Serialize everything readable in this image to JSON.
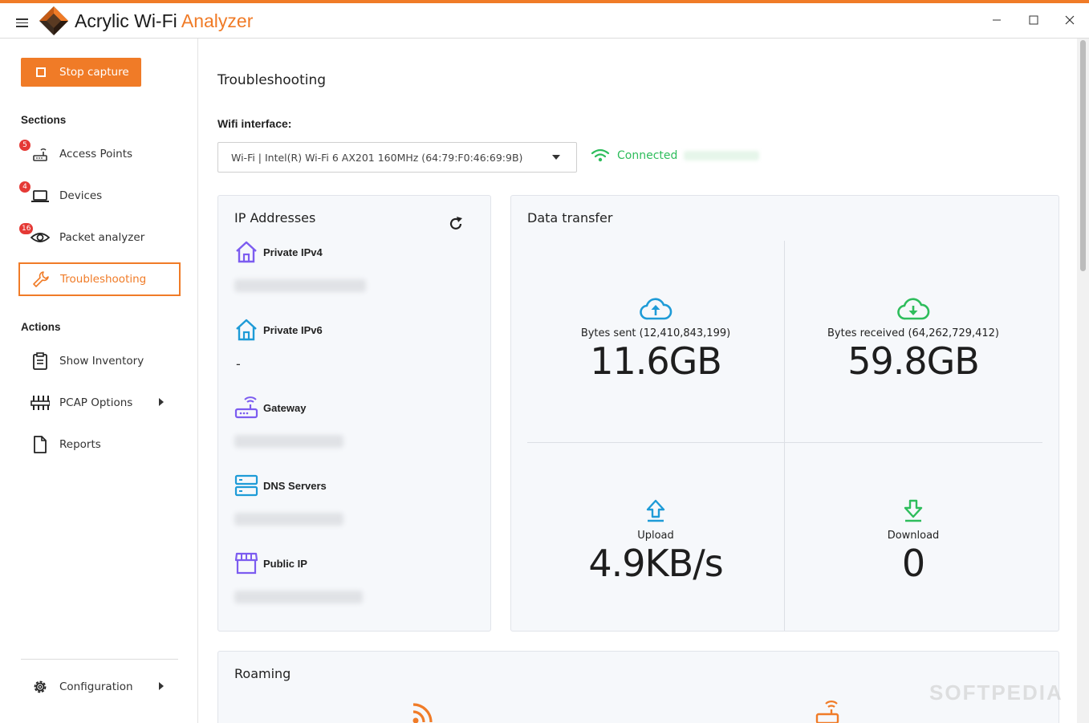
{
  "app": {
    "title_main": "Acrylic Wi-Fi ",
    "title_accent": "Analyzer",
    "accent_color": "#f07b27"
  },
  "window_controls": {
    "minimize_icon": "minimize-icon",
    "maximize_icon": "maximize-icon",
    "close_icon": "close-icon"
  },
  "sidebar": {
    "stop_button": "Stop capture",
    "sections_heading": "Sections",
    "sections": [
      {
        "label": "Access Points",
        "badge": "5",
        "icon": "router-icon"
      },
      {
        "label": "Devices",
        "badge": "4",
        "icon": "laptop-icon"
      },
      {
        "label": "Packet analyzer",
        "badge": "16",
        "icon": "eye-icon"
      },
      {
        "label": "Troubleshooting",
        "badge": "",
        "icon": "wrench-icon",
        "active": true
      }
    ],
    "actions_heading": "Actions",
    "actions": [
      {
        "label": "Show Inventory",
        "icon": "clipboard-icon"
      },
      {
        "label": "PCAP Options",
        "icon": "sliders-icon"
      },
      {
        "label": "Reports",
        "icon": "document-icon"
      }
    ],
    "configuration": "Configuration"
  },
  "main": {
    "page_title": "Troubleshooting",
    "wifi_label": "Wifi interface:",
    "interface_value": "Wi-Fi | Intel(R) Wi-Fi 6 AX201 160MHz (64:79:F0:46:69:9B)",
    "connection_status": "Connected",
    "ip_card": {
      "title": "IP Addresses",
      "rows": [
        {
          "label": "Private IPv4",
          "value_hidden": true
        },
        {
          "label": "Private IPv6",
          "value": "-"
        },
        {
          "label": "Gateway",
          "value_hidden": true
        },
        {
          "label": "DNS Servers",
          "value_hidden": true
        },
        {
          "label": "Public IP",
          "value_hidden": true
        }
      ]
    },
    "data_card": {
      "title": "Data transfer",
      "cells": [
        {
          "label": "Bytes sent (12,410,843,199)",
          "value": "11.6GB"
        },
        {
          "label": "Bytes received (64,262,729,412)",
          "value": "59.8GB"
        },
        {
          "label": "Upload",
          "value": "4.9KB/s"
        },
        {
          "label": "Download",
          "value": "0"
        }
      ]
    },
    "roaming_card": {
      "title": "Roaming"
    }
  },
  "watermark": "SOFTPEDIA"
}
